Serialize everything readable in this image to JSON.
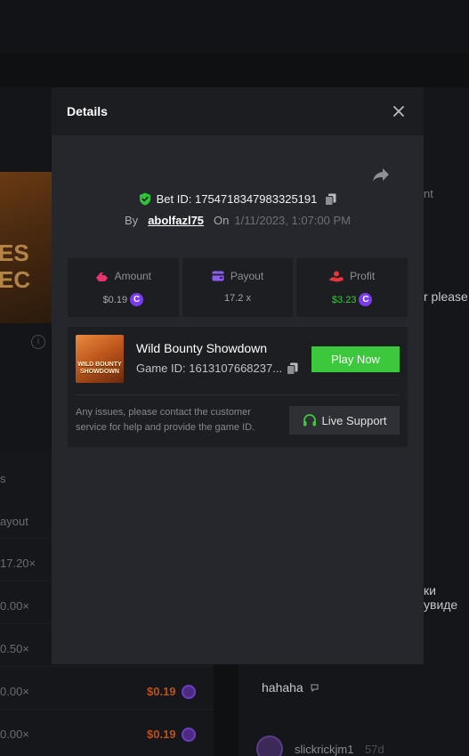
{
  "background": {
    "game_thumb_text": "ES\nEC",
    "payout_header": "ayout",
    "s_label": "s",
    "rows": [
      {
        "mult": "17.20×",
        "amount": ""
      },
      {
        "mult": "0.00×",
        "amount": ""
      },
      {
        "mult": "0.50×",
        "amount": ""
      },
      {
        "mult": "0.00×",
        "amount": "$0.19"
      },
      {
        "mult": "0.00×",
        "amount": "$0.19"
      }
    ],
    "chat": {
      "snippet_1": "nt",
      "snippet_2": "r please",
      "snippet_3": "ки увиде",
      "message": "hahaha",
      "username": "slickrickjm1",
      "time": "57d"
    }
  },
  "modal": {
    "title": "Details",
    "bet_id": "Bet ID: 1754718347983325191",
    "by_label": "By",
    "username": "abolfazl75",
    "on_label": "On",
    "date": "1/11/2023, 1:07:00 PM",
    "stats": [
      {
        "label": "Amount",
        "value": "$0.19",
        "icon": "amount-icon",
        "currency": "C"
      },
      {
        "label": "Payout",
        "value": "17.2 x",
        "icon": "wallet-icon"
      },
      {
        "label": "Profit",
        "value": "$3.23",
        "icon": "profit-icon",
        "currency": "C"
      }
    ],
    "game": {
      "name": "Wild Bounty Showdown",
      "game_id": "Game ID: 1613107668237...",
      "thumb_text": "WILD BOUNTY SHOWDOWN",
      "play_label": "Play Now"
    },
    "support": {
      "text": "Any issues, please contact the customer service for help and provide the game ID.",
      "button_label": "Live Support"
    }
  },
  "colors": {
    "accent_green": "#3cc83c",
    "profit_green": "#2fd02f",
    "currency_purple": "#7a3cf2",
    "amount_pink": "#e8356b"
  }
}
